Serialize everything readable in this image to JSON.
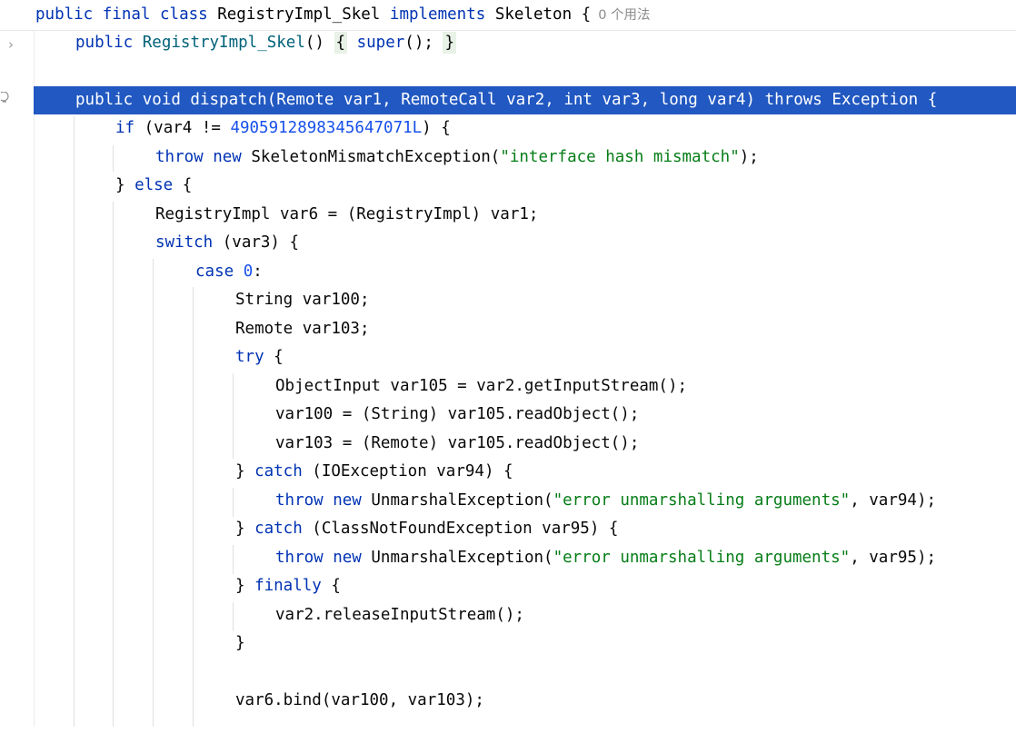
{
  "sticky_header": {
    "kw_public": "public",
    "kw_final": "final",
    "kw_class": "class",
    "class_name": "RegistryImpl_Skel",
    "kw_implements": "implements",
    "iface": "Skeleton",
    "brace": "{",
    "usages": "0 个用法"
  },
  "lines": {
    "ctor": {
      "kw": "public",
      "name": "RegistryImpl_Skel",
      "parens": "()",
      "open": "{",
      "kw_super": "super",
      "call": "();",
      "close": "}"
    },
    "dispatch": "public void dispatch(Remote var1, RemoteCall var2, int var3, long var4) throws Exception {",
    "if_kw": "if",
    "if_cond": "(var4 != ",
    "if_num": "4905912898345647071L",
    "if_end": ") {",
    "throw1_kw": "throw",
    "throw1_new": "new",
    "throw1_type": "SkeletonMismatchException(",
    "throw1_str": "\"interface hash mismatch\"",
    "throw1_end": ");",
    "else_open": "} ",
    "else_kw": "else",
    "else_end": " {",
    "registry_decl": "RegistryImpl var6 = (RegistryImpl) var1;",
    "switch_kw": "switch",
    "switch_rest": " (var3) {",
    "case_kw": "case",
    "case_num": "0",
    "case_end": ":",
    "string_decl": "String var100;",
    "remote_decl": "Remote var103;",
    "try_kw": "try",
    "try_end": " {",
    "objinput": "ObjectInput var105 = var2.getInputStream();",
    "var100_assign": "var100 = (String) var105.readObject();",
    "var103_assign": "var103 = (Remote) var105.readObject();",
    "catch1_open": "} ",
    "catch1_kw": "catch",
    "catch1_rest": " (IOException var94) {",
    "throw2_kw": "throw",
    "throw2_new": "new",
    "throw2_type": "UnmarshalException(",
    "throw2_str": "\"error unmarshalling arguments\"",
    "throw2_end": ", var94);",
    "catch2_open": "} ",
    "catch2_kw": "catch",
    "catch2_rest": " (ClassNotFoundException var95) {",
    "throw3_kw": "throw",
    "throw3_new": "new",
    "throw3_type": "UnmarshalException(",
    "throw3_str": "\"error unmarshalling arguments\"",
    "throw3_end": ", var95);",
    "finally_open": "} ",
    "finally_kw": "finally",
    "finally_end": " {",
    "release": "var2.releaseInputStream();",
    "close_brace": "}",
    "bind": "var6.bind(var100, var103);"
  },
  "icons": {
    "fold": "chevron-right-icon",
    "gutter": "bulb-icon"
  },
  "colors": {
    "keyword": "#0033b3",
    "number": "#1750eb",
    "string": "#067d17",
    "selection": "#2158c1"
  }
}
